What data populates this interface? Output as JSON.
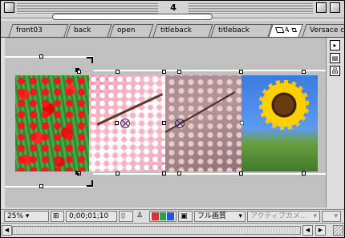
{
  "window": {
    "title": "4"
  },
  "tabs": [
    {
      "label": "front03"
    },
    {
      "label": "back"
    },
    {
      "label": "open"
    },
    {
      "label": "titleback"
    },
    {
      "label": "titleback"
    },
    {
      "label": "4",
      "active": true
    },
    {
      "label": "Versace c"
    }
  ],
  "statusbar": {
    "zoom": "25%",
    "timecode": "0;00;01;10",
    "resolution": "フル画質",
    "camera": "アクティブカメ..."
  },
  "icons": {
    "close": "close-box-icon",
    "zoom": "zoom-box-icon",
    "collapse": "collapse-box-icon",
    "menu": "menu-icon",
    "comp": "composition-icon",
    "flowchart": "flowchart-icon",
    "camera": "snapshot-camera-icon",
    "person": "show-snapshot-icon",
    "channels": "rgb-channels-icon",
    "region": "region-of-interest-icon",
    "grid": "grid-icon"
  },
  "colors": {
    "channel_r": "#e03030",
    "channel_g": "#30a040",
    "channel_b": "#3050e0",
    "selection": "#ff00ff"
  }
}
